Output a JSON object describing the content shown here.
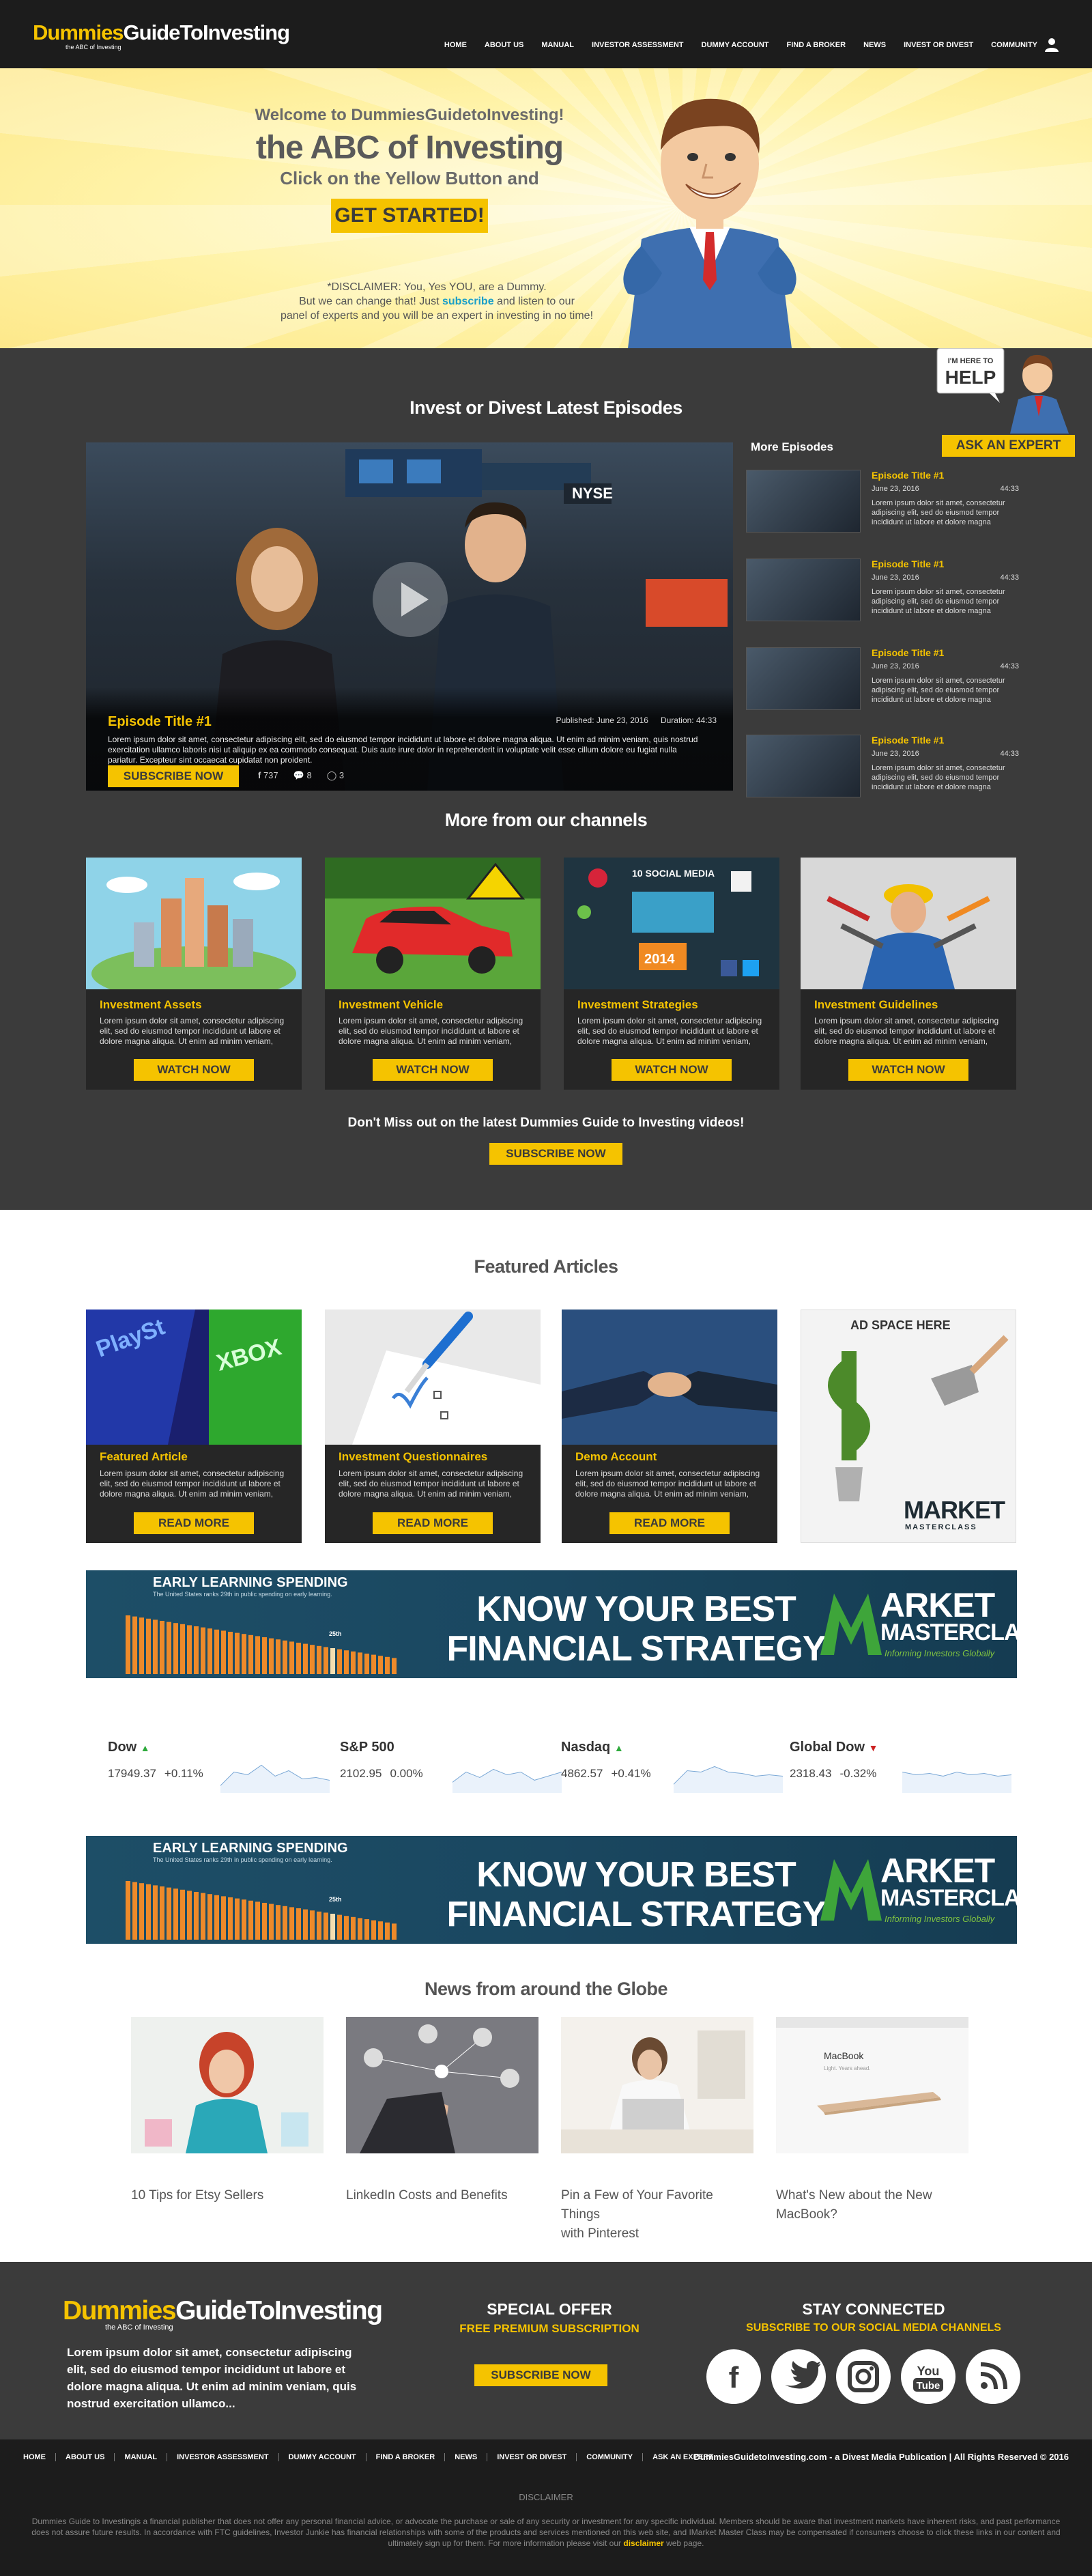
{
  "header": {
    "logo_part1": "Dummies",
    "logo_part2": "GuideToInvesting",
    "logo_tagline": "the ABC of Investing",
    "nav": [
      "HOME",
      "ABOUT US",
      "MANUAL",
      "INVESTOR ASSESSMENT",
      "DUMMY ACCOUNT",
      "FIND A BROKER",
      "NEWS",
      "INVEST OR DIVEST",
      "COMMUNITY"
    ],
    "user_icon": "user-icon"
  },
  "hero": {
    "welcome": "Welcome to DummiesGuidetoInvesting!",
    "title": "the ABC of Investing",
    "subtitle": "Click on the Yellow Button and",
    "cta": "GET STARTED!",
    "disclaimer_line1": "*DISCLAIMER: You, Yes YOU, are a Dummy.",
    "disclaimer_line2a": "But we can change that!  Just ",
    "disclaimer_link": "subscribe",
    "disclaimer_line2b": " and listen to our",
    "disclaimer_line3": "panel of experts and you will be an expert in investing in no time!"
  },
  "help": {
    "bubble_line1": "I'M HERE TO",
    "bubble_line2": "HELP",
    "button": "ASK AN EXPERT"
  },
  "episodes": {
    "section_title": "Invest or Divest Latest Episodes",
    "main": {
      "title": "Episode Title #1",
      "published": "Published: June 23, 2016",
      "duration": "Duration: 44:33",
      "description": "Lorem ipsum dolor sit amet, consectetur adipiscing elit, sed do eiusmod tempor incididunt ut labore et dolore magna aliqua. Ut enim ad  minim veniam, quis nostrud exercitation ullamco laboris nisi ut aliquip ex ea commodo consequat. Duis aute irure dolor in reprehenderit  in voluptate velit esse cillum dolore eu fugiat nulla pariatur. Excepteur sint occaecat cupidatat non proident.",
      "subscribe": "SUBSCRIBE NOW",
      "facebook_count": "737",
      "comments_count": "8",
      "replies_count": "3"
    },
    "more_title": "More Episodes",
    "more": [
      {
        "title": "Episode Title #1",
        "date": "June 23, 2016",
        "duration": "44:33",
        "text": "Lorem ipsum dolor sit amet, consectetur adipiscing elit, sed do eiusmod tempor incididunt ut labore et dolore magna"
      },
      {
        "title": "Episode Title #1",
        "date": "June 23, 2016",
        "duration": "44:33",
        "text": "Lorem ipsum dolor sit amet, consectetur adipiscing elit, sed do eiusmod tempor incididunt ut labore et dolore magna"
      },
      {
        "title": "Episode Title #1",
        "date": "June 23, 2016",
        "duration": "44:33",
        "text": "Lorem ipsum dolor sit amet, consectetur adipiscing elit, sed do eiusmod tempor incididunt ut labore et dolore magna"
      },
      {
        "title": "Episode Title #1",
        "date": "June 23, 2016",
        "duration": "44:33",
        "text": "Lorem ipsum dolor sit amet, consectetur adipiscing elit, sed do eiusmod tempor incididunt ut labore et dolore magna"
      }
    ]
  },
  "channels": {
    "section_title": "More from our channels",
    "cards": [
      {
        "title": "Investment Assets",
        "text": "Lorem ipsum dolor sit amet, consectetur adipiscing elit, sed do eiusmod tempor incididunt ut labore et dolore magna aliqua. Ut enim ad  minim veniam,",
        "button": "WATCH NOW"
      },
      {
        "title": "Investment Vehicle",
        "text": "Lorem ipsum dolor sit amet, consectetur adipiscing elit, sed do eiusmod tempor incididunt ut labore et dolore magna aliqua. Ut enim ad  minim veniam,",
        "button": "WATCH NOW"
      },
      {
        "title": "Investment Strategies",
        "text": "Lorem ipsum dolor sit amet, consectetur adipiscing elit, sed do eiusmod tempor incididunt ut labore et dolore magna aliqua. Ut enim ad  minim veniam,",
        "button": "WATCH NOW"
      },
      {
        "title": "Investment Guidelines",
        "text": "Lorem ipsum dolor sit amet, consectetur adipiscing elit, sed do eiusmod tempor incididunt ut labore et dolore magna aliqua. Ut enim ad  minim veniam,",
        "button": "WATCH NOW"
      }
    ],
    "social_infographic_title": "10 SOCIAL MEDIA",
    "social_infographic_year": "2014",
    "dont_miss": "Don't Miss out on the latest Dummies Guide to Investing videos!",
    "dont_miss_button": "SUBSCRIBE NOW"
  },
  "featured": {
    "section_title": "Featured Articles",
    "cards": [
      {
        "title": "Featured Article",
        "text": "Lorem ipsum dolor sit amet, consectetur adipiscing elit, sed do eiusmod tempor incididunt ut labore et dolore magna aliqua. Ut enim ad  minim veniam,",
        "button": "READ MORE"
      },
      {
        "title": "Investment Questionnaires",
        "text": "Lorem ipsum dolor sit amet, consectetur adipiscing elit, sed do eiusmod tempor incididunt ut labore et dolore magna aliqua. Ut enim ad  minim veniam,",
        "button": "READ MORE"
      },
      {
        "title": "Demo Account",
        "text": "Lorem ipsum dolor sit amet, consectetur adipiscing elit, sed do eiusmod tempor incididunt ut labore et dolore magna aliqua. Ut enim ad  minim veniam,",
        "button": "READ MORE"
      }
    ],
    "ad_label": "AD SPACE HERE",
    "ad_brand_line1": "MARKET",
    "ad_brand_line2": "MASTERCLASS"
  },
  "banner": {
    "chart_title": "EARLY LEARNING SPENDING",
    "chart_subtitle": "The United States ranks  29th in public spending on early learning.",
    "chart_marker": "25th",
    "headline_line1": "KNOW YOUR BEST",
    "headline_line2": "FINANCIAL STRATEGY",
    "brand_line1": "ARKET",
    "brand_line2": "MASTERCLASS",
    "brand_tagline": "Informing Investors Globally"
  },
  "tickers": [
    {
      "name": "Dow",
      "value": "17949.37",
      "change": "+0.11%",
      "direction": "up",
      "color": "#2eaa3c"
    },
    {
      "name": "S&P 500",
      "value": "2102.95",
      "change": "0.00%",
      "direction": "none",
      "color": "#444444"
    },
    {
      "name": "Nasdaq",
      "value": "4862.57",
      "change": "+0.41%",
      "direction": "up",
      "color": "#2eaa3c"
    },
    {
      "name": "Global Dow",
      "value": "2318.43",
      "change": "-0.32%",
      "direction": "down",
      "color": "#cc2222"
    }
  ],
  "news": {
    "section_title": "News from around the Globe",
    "items": [
      {
        "title_line1": "10 Tips for Etsy Sellers",
        "title_line2": ""
      },
      {
        "title_line1": "LinkedIn Costs and Benefits",
        "title_line2": ""
      },
      {
        "title_line1": "Pin a Few of Your Favorite Things",
        "title_line2": "with Pinterest"
      },
      {
        "title_line1": "What's New about the New",
        "title_line2": "MacBook?"
      }
    ],
    "macbook_label": "MacBook",
    "macbook_sub": "Light. Years ahead."
  },
  "footer": {
    "logo_part1": "Dummies",
    "logo_part2": "GuideToInvesting",
    "logo_tagline": "the ABC of Investing",
    "text": "Lorem ipsum dolor sit amet, consectetur adipiscing elit, sed do eiusmod tempor incididunt ut labore et dolore magna aliqua. Ut enim ad minim veniam, quis nostrud exercitation ullamco...",
    "offer_title": "SPECIAL OFFER",
    "offer_sub": "FREE PREMIUM SUBSCRIPTION",
    "offer_button": "SUBSCRIBE NOW",
    "stay_title": "STAY CONNECTED",
    "stay_sub": "SUBSCRIBE TO OUR SOCIAL MEDIA CHANNELS",
    "social_icons": [
      "facebook-icon",
      "twitter-icon",
      "instagram-icon",
      "youtube-icon",
      "rss-icon"
    ],
    "youtube_you": "You",
    "youtube_tube": "Tube"
  },
  "bottombar": {
    "nav": [
      "HOME",
      "ABOUT US",
      "MANUAL",
      "INVESTOR ASSESSMENT",
      "DUMMY ACCOUNT",
      "FIND A BROKER",
      "NEWS",
      "INVEST OR DIVEST",
      "COMMUNITY",
      "ASK AN EXPERT"
    ],
    "copyright": "DummiesGuidetoInvesting.com - a Divest Media Publication  |  All Rights Reserved © 2016",
    "disclaimer_title": "DISCLAIMER",
    "disclaimer_text_a": "Dummies Guide to Investingis a financial publisher that does not offer any personal financial advice, or advocate the purchase or sale of any security or investment for any specific individual. Members should be aware that investment markets have inherent risks, and past performance does not assure future results. In accordance with FTC guidelines, Investor Junkie has financial relationships with some of the products and services mentioned on this web site, and IMarket Master Class may be compensated if consumers choose to click these links in our content and ultimately sign up for them. For more information please visit our ",
    "disclaimer_link": "disclaimer",
    "disclaimer_text_b": " web page."
  },
  "colors": {
    "accent": "#f5c300",
    "dark": "#3b3b3b",
    "black": "#1c1c1c"
  }
}
